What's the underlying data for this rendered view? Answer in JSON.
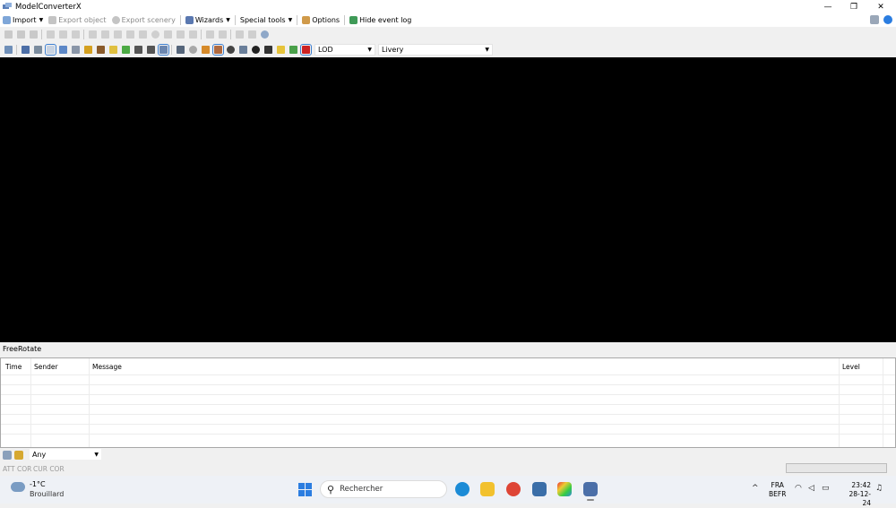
{
  "window": {
    "title": "ModelConverterX",
    "controls": {
      "minimize": "—",
      "restore": "❐",
      "close": "✕"
    }
  },
  "menu": {
    "import": "Import",
    "export_object": "Export object",
    "export_scenery": "Export scenery",
    "wizards": "Wizards",
    "special_tools": "Special tools",
    "options": "Options",
    "hide_event_log": "Hide event log",
    "dropdown_arrow": "▼"
  },
  "toolbar2": {
    "lod_label": "LOD",
    "livery_label": "Livery"
  },
  "panel": {
    "title": "FreeRotate"
  },
  "log": {
    "columns": [
      "Time",
      "Sender",
      "Message",
      "Level"
    ],
    "rows": []
  },
  "filter": {
    "value": "Any"
  },
  "status": {
    "att": "ATT COR",
    "cur": "CUR COR"
  },
  "taskbar": {
    "temperature": "-1°C",
    "weather": "Brouillard",
    "search_placeholder": "Rechercher",
    "lang_top": "FRA",
    "lang_bottom": "BEFR",
    "time": "23:42",
    "date": "28-12-24",
    "tray_chevron": "^"
  },
  "colors": {
    "viewport": "#000000",
    "accent": "#2b7de0"
  }
}
